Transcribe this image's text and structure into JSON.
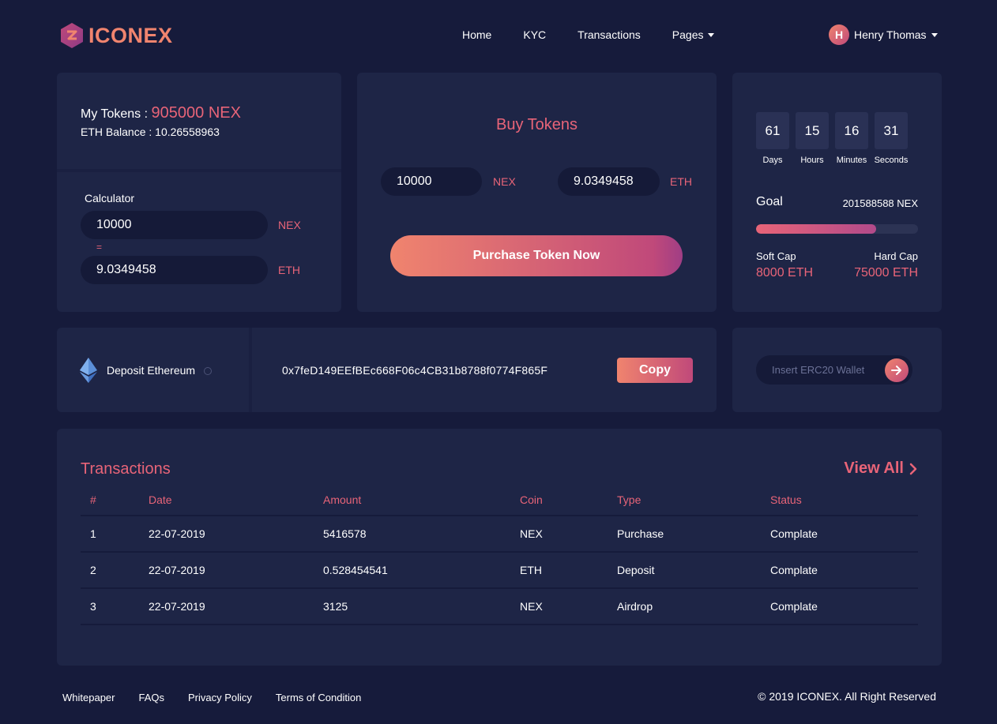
{
  "header": {
    "brand": "ICONEX",
    "nav": [
      {
        "label": "Home"
      },
      {
        "label": "KYC"
      },
      {
        "label": "Transactions"
      },
      {
        "label": "Pages"
      }
    ],
    "user": {
      "initial": "H",
      "name": "Henry Thomas"
    }
  },
  "tokens": {
    "my_tokens_label": "My Tokens :",
    "my_tokens_value": "905000 NEX",
    "eth_balance": "ETH Balance : 10.26558963",
    "calculator_label": "Calculator",
    "calc_amount": "10000",
    "calc_unit_from": "NEX",
    "equals": "=",
    "calc_result": "9.0349458",
    "calc_unit_to": "ETH"
  },
  "buy": {
    "title": "Buy Tokens",
    "nex_amount": "10000",
    "nex_unit": "NEX",
    "eth_amount": "9.0349458",
    "eth_unit": "ETH",
    "purchase_label": "Purchase Token Now"
  },
  "countdown": {
    "units": [
      {
        "value": "61",
        "label": "Days"
      },
      {
        "value": "15",
        "label": "Hours"
      },
      {
        "value": "16",
        "label": "Minutes"
      },
      {
        "value": "31",
        "label": "Seconds"
      }
    ],
    "goal_label": "Goal",
    "goal_value": "201588588 NEX",
    "progress_fraction": 0.74,
    "soft_cap_label": "Soft Cap",
    "soft_cap_value": "8000 ETH",
    "hard_cap_label": "Hard Cap",
    "hard_cap_value": "75000 ETH"
  },
  "deposit": {
    "label": "Deposit Ethereum",
    "address": "0x7feD149EEfBEc668F06c4CB31b8788f0774F865F",
    "copy_label": "Copy"
  },
  "wallet": {
    "placeholder": "Insert ERC20 Wallet"
  },
  "transactions": {
    "title": "Transactions",
    "view_all": "View All",
    "columns": [
      "#",
      "Date",
      "Amount",
      "Coin",
      "Type",
      "Status"
    ],
    "rows": [
      [
        "1",
        "22-07-2019",
        "5416578",
        "NEX",
        "Purchase",
        "Complate"
      ],
      [
        "2",
        "22-07-2019",
        "0.528454541",
        "ETH",
        "Deposit",
        "Complate"
      ],
      [
        "3",
        "22-07-2019",
        "3125",
        "NEX",
        "Airdrop",
        "Complate"
      ]
    ]
  },
  "footer": {
    "links": [
      "Whitepaper",
      "FAQs",
      "Privacy Policy",
      "Terms of Condition"
    ],
    "copyright": "© 2019 ICONEX. All Right Reserved"
  },
  "colors": {
    "background": "#161b3b",
    "card": "#1e2546",
    "accent": "#e86478",
    "gradient_start": "#f0846e",
    "gradient_end": "#c0497a"
  }
}
